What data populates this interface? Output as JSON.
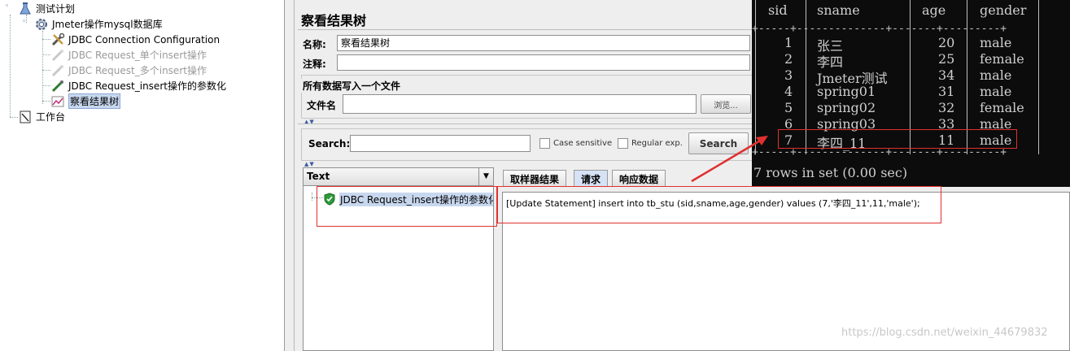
{
  "tree": {
    "items": [
      {
        "label": "测试计划",
        "icon": "test-plan-flask-icon",
        "enabled": true
      },
      {
        "label": "Jmeter操作mysql数据库",
        "icon": "thread-group-gear-icon",
        "enabled": true
      },
      {
        "label": "JDBC Connection Configuration",
        "icon": "config-wrench-icon",
        "enabled": true
      },
      {
        "label": "JDBC Request_单个insert操作",
        "icon": "sampler-pipette-icon",
        "enabled": false
      },
      {
        "label": "JDBC Request_多个insert操作",
        "icon": "sampler-pipette-icon",
        "enabled": false
      },
      {
        "label": "JDBC Request_insert操作的参数化",
        "icon": "sampler-pipette-icon",
        "enabled": true
      },
      {
        "label": "察看结果树",
        "icon": "listener-chart-icon",
        "enabled": true,
        "selected": true
      },
      {
        "label": "工作台",
        "icon": "workbench-notepad-icon",
        "enabled": true
      }
    ]
  },
  "panel": {
    "title": "察看结果树",
    "name_label": "名称:",
    "name_value": "察看结果树",
    "comment_label": "注释:",
    "comment_value": "",
    "file_group_title": "所有数据写入一个文件",
    "file_label": "文件名",
    "file_value": "",
    "browse_label": "浏览..."
  },
  "search": {
    "label": "Search:",
    "value": "",
    "case_sensitive_label": "Case sensitive",
    "case_sensitive_checked": false,
    "regex_label": "Regular exp.",
    "regex_checked": false,
    "button_label": "Search"
  },
  "results": {
    "renderer_selected": "Text",
    "items": [
      {
        "label": "JDBC Request_insert操作的参数化",
        "status": "success"
      }
    ]
  },
  "detail": {
    "tabs": [
      {
        "label": "取样器结果",
        "active": false
      },
      {
        "label": "请求",
        "active": true
      },
      {
        "label": "响应数据",
        "active": false
      }
    ],
    "request_text": "[Update Statement] insert into tb_stu (sid,sname,age,gender) values (7,'李四_11',11,'male');"
  },
  "terminal": {
    "columns": [
      "sid",
      "sname",
      "age",
      "gender"
    ],
    "rows": [
      [
        "1",
        "张三",
        "20",
        "male"
      ],
      [
        "2",
        "李四",
        "25",
        "female"
      ],
      [
        "3",
        "Jmeter测试",
        "34",
        "male"
      ],
      [
        "4",
        "spring01",
        "31",
        "male"
      ],
      [
        "5",
        "spring02",
        "32",
        "female"
      ],
      [
        "6",
        "spring03",
        "33",
        "male"
      ],
      [
        "7",
        "李四_11",
        "11",
        "male"
      ]
    ],
    "footer": "7 rows in set (0.00 sec)"
  },
  "watermark": "https://blog.csdn.net/weixin_44679832",
  "colors": {
    "annotation_red": "#e03030",
    "selection_blue": "#c7d7ee",
    "terminal_bg": "#0c0c0c"
  }
}
